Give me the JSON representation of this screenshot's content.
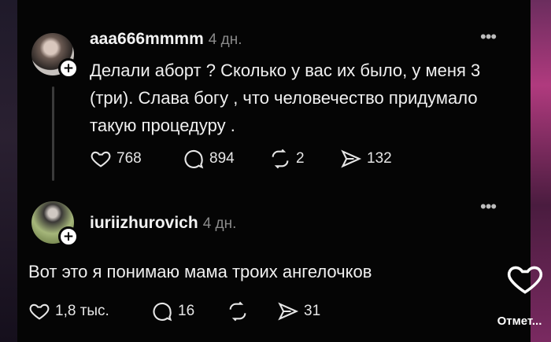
{
  "post": {
    "username": "aaa666mmmm",
    "time": "4 дн.",
    "text": "Делали аборт ? Сколько у вас их было, у меня 3 (три). Слава богу , что человечество придумало такую процедуру .",
    "likes": "768",
    "comments": "894",
    "reposts": "2",
    "shares": "132"
  },
  "reply": {
    "username": "iuriizhurovich",
    "time": "4 дн.",
    "text": "Вот это я понимаю мама троих ангелочков",
    "likes": "1,8 тыс.",
    "comments": "16",
    "shares": "31"
  },
  "overlay": {
    "mark_label": "Отмет..."
  },
  "icons": {
    "like": "heart-icon",
    "comment": "comment-bubble-icon",
    "repost": "repost-icon",
    "share": "send-icon",
    "more": "more-dots-icon",
    "follow": "plus-icon"
  },
  "colors": {
    "background": "#050505",
    "text": "#f2f2f2",
    "muted": "#8a8a8a"
  }
}
